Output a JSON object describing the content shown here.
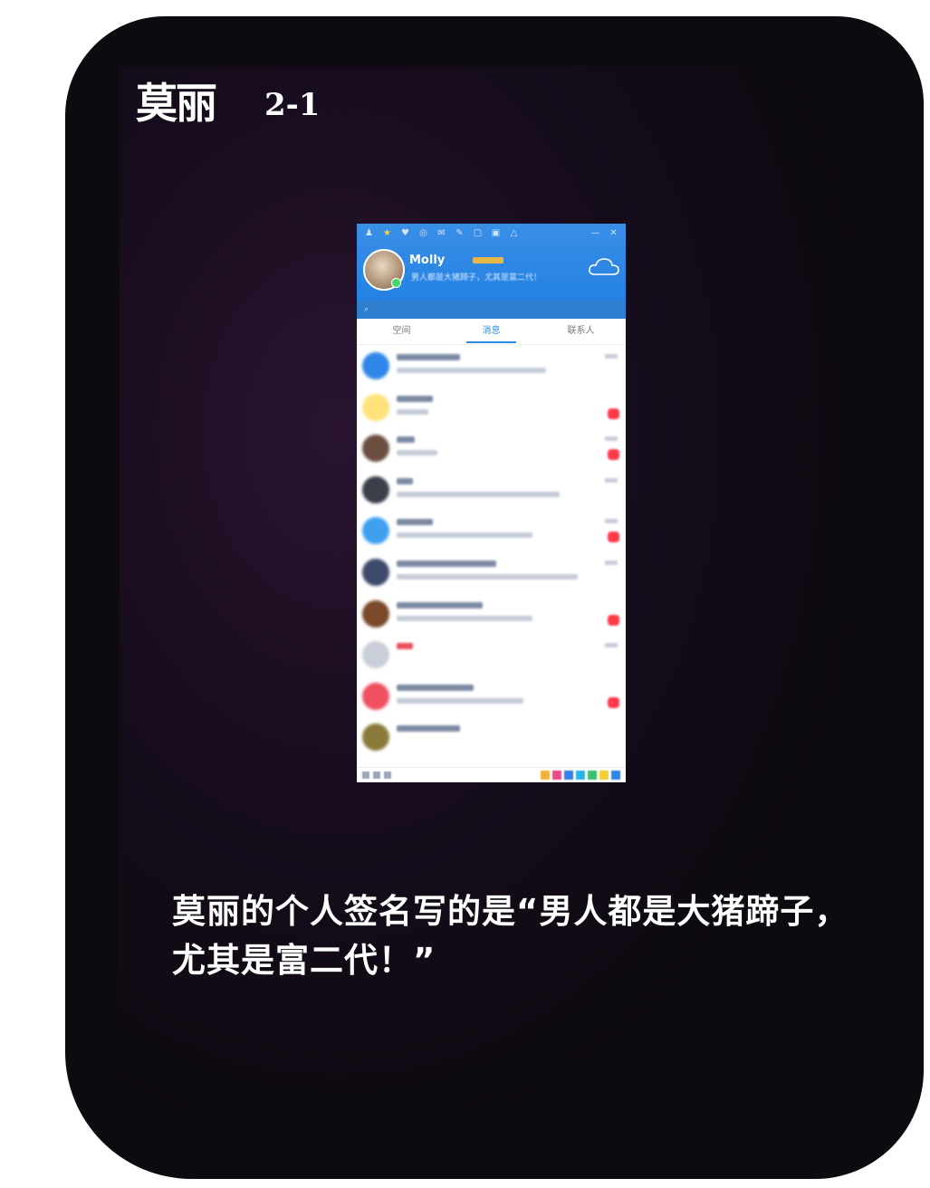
{
  "header": {
    "name": "莫丽",
    "index": "2-1"
  },
  "profile": {
    "nickname": "Molly",
    "signature": "男人都是大猪蹄子，尤其是富二代！"
  },
  "tabs": [
    "空间",
    "消息",
    "联系人"
  ],
  "active_tab": 1,
  "caption": "莫丽的个人签名写的是“男人都是大猪蹄子，尤其是富二代！”",
  "icons": [
    "qq-icon",
    "star-icon",
    "settings-icon",
    "cloud-icon",
    "search-icon"
  ],
  "colors": {
    "qq_blue": "#1f7fe3",
    "unread_red": "#ff3b4a",
    "background": "#0d0a10"
  }
}
